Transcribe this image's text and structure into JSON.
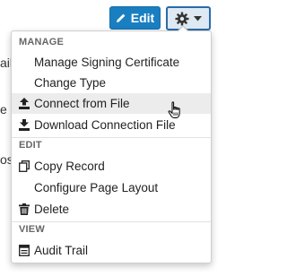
{
  "background": {
    "fragments": [
      "ail",
      "e",
      "os"
    ]
  },
  "toolbar": {
    "edit_label": "Edit"
  },
  "menu": {
    "sections": {
      "manage": "MANAGE",
      "edit": "EDIT",
      "view": "VIEW"
    },
    "items": {
      "manage_signing_certificate": "Manage Signing Certificate",
      "change_type": "Change Type",
      "connect_from_file": "Connect from File",
      "download_connection_file": "Download Connection File",
      "copy_record": "Copy Record",
      "configure_page_layout": "Configure Page Layout",
      "delete": "Delete",
      "audit_trail": "Audit Trail"
    }
  },
  "colors": {
    "edit_button": "#1a7fc1",
    "gear_button_border": "#2a6ba8",
    "hover_row": "#ececec"
  },
  "icons": {
    "edit": "pencil-icon",
    "gear": "gear-icon",
    "caret": "caret-down-icon",
    "connect": "upload-icon",
    "download": "download-icon",
    "copy": "copy-icon",
    "delete": "trash-icon",
    "audit": "list-icon",
    "cursor": "hand-pointer-icon"
  }
}
